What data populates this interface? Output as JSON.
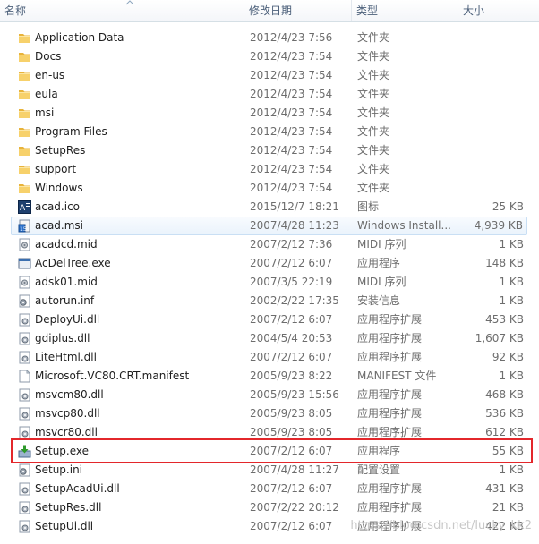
{
  "header": {
    "name_label": "名称",
    "date_label": "修改日期",
    "type_label": "类型",
    "size_label": "大小"
  },
  "files": [
    {
      "name": "Application Data",
      "date": "2012/4/23 7:56",
      "type": "文件夹",
      "size": "",
      "icon": "folder-icon"
    },
    {
      "name": "Docs",
      "date": "2012/4/23 7:54",
      "type": "文件夹",
      "size": "",
      "icon": "folder-icon"
    },
    {
      "name": "en-us",
      "date": "2012/4/23 7:54",
      "type": "文件夹",
      "size": "",
      "icon": "folder-icon"
    },
    {
      "name": "eula",
      "date": "2012/4/23 7:54",
      "type": "文件夹",
      "size": "",
      "icon": "folder-icon"
    },
    {
      "name": "msi",
      "date": "2012/4/23 7:54",
      "type": "文件夹",
      "size": "",
      "icon": "folder-icon"
    },
    {
      "name": "Program Files",
      "date": "2012/4/23 7:54",
      "type": "文件夹",
      "size": "",
      "icon": "folder-icon"
    },
    {
      "name": "SetupRes",
      "date": "2012/4/23 7:54",
      "type": "文件夹",
      "size": "",
      "icon": "folder-icon"
    },
    {
      "name": "support",
      "date": "2012/4/23 7:54",
      "type": "文件夹",
      "size": "",
      "icon": "folder-icon"
    },
    {
      "name": "Windows",
      "date": "2012/4/23 7:54",
      "type": "文件夹",
      "size": "",
      "icon": "folder-icon"
    },
    {
      "name": "acad.ico",
      "date": "2015/12/7 18:21",
      "type": "图标",
      "size": "25 KB",
      "icon": "autocad-ico-icon"
    },
    {
      "name": "acad.msi",
      "date": "2007/4/28 11:23",
      "type": "Windows Install...",
      "size": "4,939 KB",
      "icon": "msi-package-icon"
    },
    {
      "name": "acadcd.mid",
      "date": "2007/2/12 7:36",
      "type": "MIDI 序列",
      "size": "1 KB",
      "icon": "media-file-icon"
    },
    {
      "name": "AcDelTree.exe",
      "date": "2007/2/12 6:07",
      "type": "应用程序",
      "size": "148 KB",
      "icon": "application-icon"
    },
    {
      "name": "adsk01.mid",
      "date": "2007/3/5 22:19",
      "type": "MIDI 序列",
      "size": "1 KB",
      "icon": "media-file-icon"
    },
    {
      "name": "autorun.inf",
      "date": "2002/2/22 17:35",
      "type": "安装信息",
      "size": "1 KB",
      "icon": "settings-file-icon"
    },
    {
      "name": "DeployUi.dll",
      "date": "2007/2/12 6:07",
      "type": "应用程序扩展",
      "size": "453 KB",
      "icon": "dll-icon"
    },
    {
      "name": "gdiplus.dll",
      "date": "2004/5/4 20:53",
      "type": "应用程序扩展",
      "size": "1,607 KB",
      "icon": "dll-icon"
    },
    {
      "name": "LiteHtml.dll",
      "date": "2007/2/12 6:07",
      "type": "应用程序扩展",
      "size": "92 KB",
      "icon": "dll-icon"
    },
    {
      "name": "Microsoft.VC80.CRT.manifest",
      "date": "2005/9/23 8:22",
      "type": "MANIFEST 文件",
      "size": "1 KB",
      "icon": "blank-file-icon"
    },
    {
      "name": "msvcm80.dll",
      "date": "2005/9/23 15:56",
      "type": "应用程序扩展",
      "size": "468 KB",
      "icon": "dll-icon"
    },
    {
      "name": "msvcp80.dll",
      "date": "2005/9/23 8:05",
      "type": "应用程序扩展",
      "size": "536 KB",
      "icon": "dll-icon"
    },
    {
      "name": "msvcr80.dll",
      "date": "2005/9/23 8:05",
      "type": "应用程序扩展",
      "size": "612 KB",
      "icon": "dll-icon"
    },
    {
      "name": "Setup.exe",
      "date": "2007/2/12 6:07",
      "type": "应用程序",
      "size": "55 KB",
      "icon": "setup-installer-icon"
    },
    {
      "name": "Setup.ini",
      "date": "2007/4/28 11:27",
      "type": "配置设置",
      "size": "1 KB",
      "icon": "settings-file-icon"
    },
    {
      "name": "SetupAcadUi.dll",
      "date": "2007/2/12 6:07",
      "type": "应用程序扩展",
      "size": "431 KB",
      "icon": "dll-icon"
    },
    {
      "name": "SetupRes.dll",
      "date": "2007/2/22 20:12",
      "type": "应用程序扩展",
      "size": "21 KB",
      "icon": "dll-icon"
    },
    {
      "name": "SetupUi.dll",
      "date": "2007/2/12 6:07",
      "type": "应用程序扩展",
      "size": "422 KB",
      "icon": "dll-icon"
    }
  ],
  "hover_index": 10,
  "highlight_index": 22,
  "watermark": "https://blog.csdn.net/lucky_kk2",
  "colors": {
    "highlight_border": "#e3272b",
    "folder": "#f0c14b",
    "hover_bg": "#eaf3fc"
  }
}
